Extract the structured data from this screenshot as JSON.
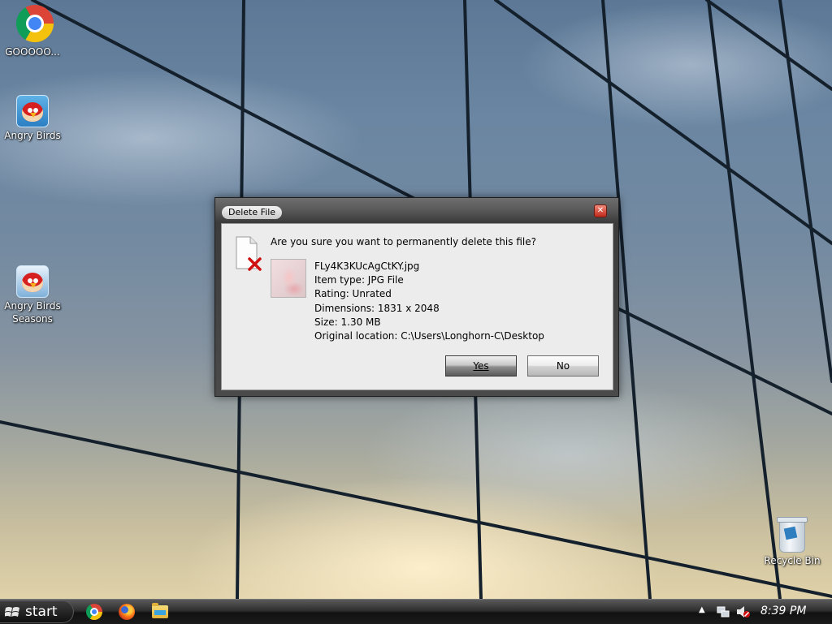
{
  "desktop": {
    "icons": [
      {
        "label": "GOOOOO..."
      },
      {
        "label": "Angry Birds"
      },
      {
        "label": "Angry Birds\nSeasons"
      },
      {
        "label": "Recycle Bin"
      }
    ]
  },
  "dialog": {
    "title": "Delete File",
    "question": "Are you sure you want to permanently delete this file?",
    "file": {
      "name": "FLy4K3KUcAgCtKY.jpg",
      "type": "Item type: JPG File",
      "rating": "Rating: Unrated",
      "dimensions": "Dimensions: 1831 x 2048",
      "size": "Size: 1.30 MB",
      "location": "Original location: C:\\Users\\Longhorn-C\\Desktop"
    },
    "yes_label": "Yes",
    "no_label": "No",
    "close_glyph": "✕"
  },
  "taskbar": {
    "start_label": "start",
    "pinned": [
      "chrome-icon",
      "firefox-icon",
      "file-explorer-icon"
    ],
    "tray_arrow": "▲",
    "clock": "8:39 PM"
  },
  "colors": {
    "dialog_frame": "#4a4a4a",
    "dialog_body": "#ececec",
    "delete_x": "#d01010",
    "taskbar": "#1b1b1b"
  }
}
